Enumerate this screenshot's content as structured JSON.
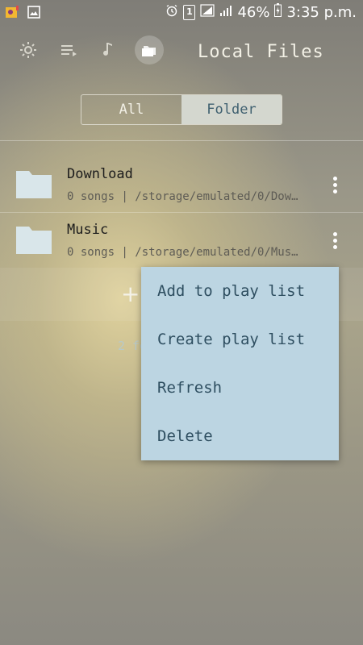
{
  "status_bar": {
    "sim_slot": "1",
    "battery": "46%",
    "time": "3:35 p.m."
  },
  "toolbar": {
    "icons": [
      "settings-icon",
      "playlist-icon",
      "music-note-icon",
      "folder-icon"
    ],
    "active_icon": "folder-icon",
    "title": "Local Files"
  },
  "segment": {
    "all_label": "All",
    "folder_label": "Folder",
    "selected": "Folder"
  },
  "folders": [
    {
      "name": "Download",
      "meta": "0 songs | /storage/emulated/0/Dow…"
    },
    {
      "name": "Music",
      "meta": "0 songs | /storage/emulated/0/Mus…"
    }
  ],
  "add_row": {
    "icon": "plus-icon"
  },
  "footer": {
    "count": "2 fo"
  },
  "context_menu": {
    "items": [
      "Add to play list",
      "Create play list",
      "Refresh",
      "Delete"
    ]
  },
  "colors": {
    "menu_bg": "#bcd5e2",
    "menu_text": "#2e4e60",
    "segment_selected_bg": "#d4d7cf",
    "folder_icon": "#d9e6ea"
  }
}
